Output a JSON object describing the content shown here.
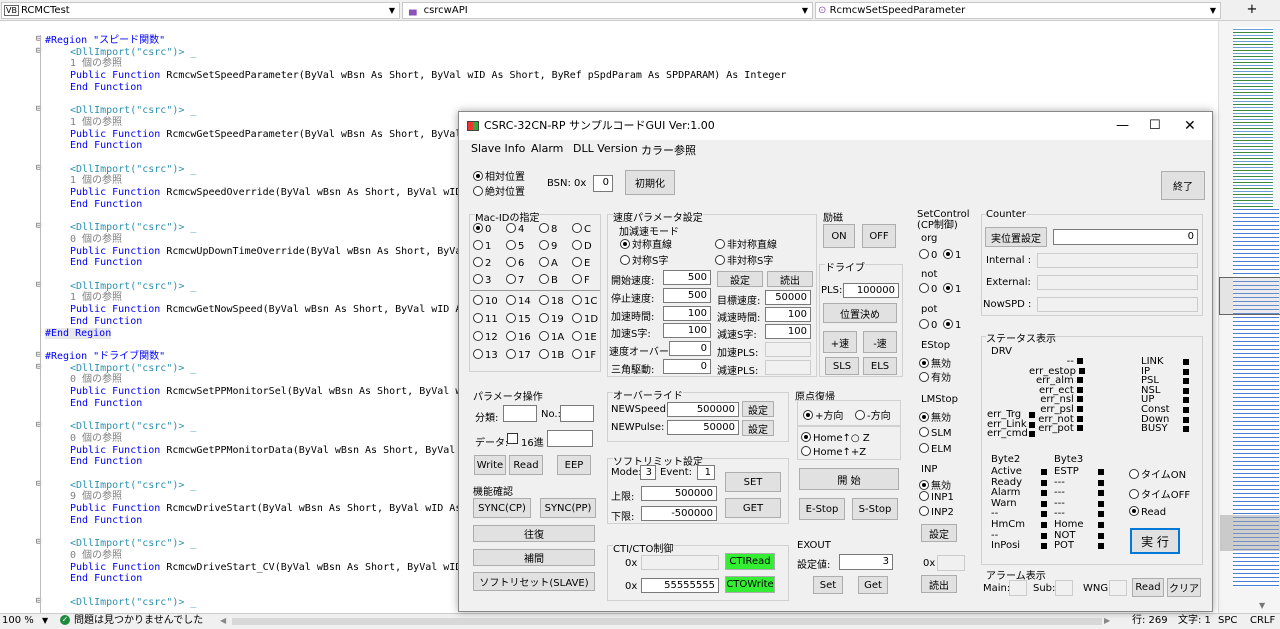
{
  "nav": {
    "project": "RCMCTest",
    "project_icon": "VB",
    "class": "csrcwAPI",
    "member": "RcmcwSetSpeedParameter",
    "split": "+"
  },
  "code": [
    {
      "t": "region",
      "text": "#Region \"スピード関数\""
    },
    {
      "t": "attr",
      "text": "<DllImport(\"csrc\")> _"
    },
    {
      "t": "ref",
      "text": "1 個の参照"
    },
    {
      "t": "fn",
      "pre": "Public Function ",
      "name": "RcmcwSetSpeedParameter",
      "args": "(ByVal wBsn As Short, ByVal wID As Short, ByRef pSpdParam As SPDPARAM) As Integer"
    },
    {
      "t": "end",
      "text": "End Function"
    },
    {
      "t": "blank",
      "text": ""
    },
    {
      "t": "attr",
      "text": "<DllImport(\"csrc\")> _"
    },
    {
      "t": "ref",
      "text": "1 個の参照"
    },
    {
      "t": "fn",
      "pre": "Public Function ",
      "name": "RcmcwGetSpeedParameter",
      "args": "(ByVal wBsn As Short, ByVal"
    },
    {
      "t": "end",
      "text": "End Function"
    },
    {
      "t": "blank",
      "text": ""
    },
    {
      "t": "attr",
      "text": "<DllImport(\"csrc\")> _"
    },
    {
      "t": "ref",
      "text": "1 個の参照"
    },
    {
      "t": "fn",
      "pre": "Public Function ",
      "name": "RcmcwSpeedOverride",
      "args": "(ByVal wBsn As Short, ByVal wID"
    },
    {
      "t": "end",
      "text": "End Function"
    },
    {
      "t": "blank",
      "text": ""
    },
    {
      "t": "attr",
      "text": "<DllImport(\"csrc\")> _"
    },
    {
      "t": "ref",
      "text": "0 個の参照"
    },
    {
      "t": "fn",
      "pre": "Public Function ",
      "name": "RcmcwUpDownTimeOverride",
      "args": "(ByVal wBsn As Short, ByVa"
    },
    {
      "t": "end",
      "text": "End Function"
    },
    {
      "t": "blank",
      "text": ""
    },
    {
      "t": "attr",
      "text": "<DllImport(\"csrc\")> _"
    },
    {
      "t": "ref",
      "text": "1 個の参照"
    },
    {
      "t": "fn",
      "pre": "Public Function ",
      "name": "RcmcwGetNowSpeed",
      "args": "(ByVal wBsn As Short, ByVal wID A"
    },
    {
      "t": "end",
      "text": "End Function"
    },
    {
      "t": "endregion",
      "text": "#End Region"
    },
    {
      "t": "blank",
      "text": ""
    },
    {
      "t": "region",
      "text": "#Region \"ドライブ関数\""
    },
    {
      "t": "attr",
      "text": "<DllImport(\"csrc\")> _"
    },
    {
      "t": "ref",
      "text": "0 個の参照"
    },
    {
      "t": "fn",
      "pre": "Public Function ",
      "name": "RcmcwSetPPMonitorSel",
      "args": "(ByVal wBsn As Short, ByVal w"
    },
    {
      "t": "end",
      "text": "End Function"
    },
    {
      "t": "blank",
      "text": ""
    },
    {
      "t": "attr",
      "text": "<DllImport(\"csrc\")> _"
    },
    {
      "t": "ref",
      "text": "0 個の参照"
    },
    {
      "t": "fn",
      "pre": "Public Function ",
      "name": "RcmcwGetPPMonitorData",
      "args": "(ByVal wBsn As Short, ByVal"
    },
    {
      "t": "end",
      "text": "End Function"
    },
    {
      "t": "blank",
      "text": ""
    },
    {
      "t": "attr",
      "text": "<DllImport(\"csrc\")> _"
    },
    {
      "t": "ref",
      "text": "9 個の参照"
    },
    {
      "t": "fn",
      "pre": "Public Function ",
      "name": "RcmcwDriveStart",
      "args": "(ByVal wBsn As Short, ByVal wID As"
    },
    {
      "t": "end",
      "text": "End Function"
    },
    {
      "t": "blank",
      "text": ""
    },
    {
      "t": "attr",
      "text": "<DllImport(\"csrc\")> _"
    },
    {
      "t": "ref",
      "text": "0 個の参照"
    },
    {
      "t": "fn",
      "pre": "Public Function ",
      "name": "RcmcwDriveStart_CV",
      "args": "(ByVal wBsn As Short, ByVal wID"
    },
    {
      "t": "end",
      "text": "End Function"
    },
    {
      "t": "blank",
      "text": ""
    },
    {
      "t": "attr",
      "text": "<DllImport(\"csrc\")> _"
    }
  ],
  "status": {
    "zoom": "100 %",
    "issues": "問題は見つかりませんでした",
    "line": "行: 269",
    "char": "文字: 1",
    "spc": "SPC",
    "crlf": "CRLF"
  },
  "dlg": {
    "title": "CSRC-32CN-RP サンプルコードGUI Ver:1.00",
    "menu": [
      "Slave Info",
      "Alarm",
      "DLL Version",
      "カラー参照"
    ],
    "pos_rel": "相対位置",
    "pos_abs": "絶対位置",
    "bsn_label": "BSN: 0x",
    "bsn_value": "0",
    "init": "初期化",
    "exit": "終了",
    "mac_title": "Mac-IDの指定",
    "mac_ids": [
      "0",
      "4",
      "8",
      "C",
      "1",
      "5",
      "9",
      "D",
      "2",
      "6",
      "A",
      "E",
      "3",
      "7",
      "B",
      "F",
      "10",
      "14",
      "18",
      "1C",
      "11",
      "15",
      "19",
      "1D",
      "12",
      "16",
      "1A",
      "1E",
      "13",
      "17",
      "1B",
      "1F"
    ],
    "speed": {
      "title": "速度パラメータ設定",
      "mode": "加減速モード",
      "sym_lin": "対称直線",
      "asym_lin": "非対称直線",
      "sym_s": "対称S字",
      "asym_s": "非対称S字",
      "start_lbl": "開始速度:",
      "start": "500",
      "stop_lbl": "停止速度:",
      "stop": "500",
      "acc_lbl": "加速時間:",
      "acc": "100",
      "accs_lbl": "加速S字:",
      "accs": "100",
      "over_lbl": "速度オーバー:",
      "over": "0",
      "tri_lbl": "三角駆動:",
      "tri": "0",
      "set": "設定",
      "read": "読出",
      "tgt_lbl": "目標速度:",
      "tgt": "50000",
      "dec_lbl": "減速時間:",
      "dec": "100",
      "decs_lbl": "減速S字:",
      "decs": "100",
      "accpls_lbl": "加速PLS:",
      "decpls_lbl": "減速PLS:"
    },
    "exc": {
      "title": "励磁",
      "on": "ON",
      "off": "OFF"
    },
    "drive": {
      "title": "ドライブ",
      "pls_lbl": "PLS:",
      "pls": "100000",
      "pos": "位置決め",
      "plus": "+速",
      "minus": "-速",
      "sls": "SLS",
      "els": "ELS"
    },
    "setctrl": {
      "title": "SetControl (CP制御)",
      "org": "org",
      "not": "not",
      "pot": "pot",
      "zero": "0",
      "one": "1",
      "estop": "EStop",
      "valid": "無効",
      "enabled": "有効"
    },
    "counter": {
      "title": "Counter",
      "actual": "実位置設定",
      "actual_val": "0",
      "internal": "Internal :",
      "external": "External:",
      "nowspd": "NowSPD :"
    },
    "st": {
      "title": "ステータス表示",
      "drv": "DRV",
      "mid": [
        "--",
        "err_estop",
        "err_alm",
        "err_ect",
        "err_nsl",
        "err_psl",
        "err_not",
        "err_pot"
      ],
      "left": [
        "err_Trg",
        "err_Link",
        "err_cmd"
      ],
      "right": [
        "LINK",
        "IP",
        "PSL",
        "NSL",
        "UP",
        "Const",
        "Down",
        "BUSY"
      ],
      "b2_title": "Byte2",
      "b2": [
        "Active",
        "Ready",
        "Alarm",
        "Warn",
        "--",
        "HmCm",
        "--",
        "InPosi"
      ],
      "b3_title": "Byte3",
      "b3": [
        "ESTP",
        "---",
        "---",
        "---",
        "---",
        "Home",
        "NOT",
        "POT"
      ],
      "t_on": "タイムON",
      "t_off": "タイムOFF",
      "read": "Read",
      "exec": "実 行"
    },
    "alarm": {
      "title": "アラーム表示",
      "main": "Main:",
      "sub": "Sub:",
      "wng": "WNG:",
      "read": "Read",
      "clear": "クリア"
    },
    "param": {
      "title": "パラメータ操作",
      "kind": "分類:",
      "no": "No.:",
      "data": "データ:",
      "hex": "16進",
      "write": "Write",
      "read": "Read",
      "eep": "EEP"
    },
    "func": {
      "title": "機能確認",
      "cp": "SYNC(CP)",
      "pp": "SYNC(PP)",
      "recip": "往復",
      "interp": "補間",
      "reset": "ソフトリセット(SLAVE)"
    },
    "ovr": {
      "title": "オーバーライド",
      "speed_lbl": "NEWSpeed:",
      "speed": "500000",
      "pulse_lbl": "NEWPulse:",
      "pulse": "50000",
      "set": "設定"
    },
    "soft": {
      "title": "ソフトリミット設定",
      "mode_lbl": "Mode:",
      "mode": "3",
      "event_lbl": "Event:",
      "event": "1",
      "up_lbl": "上限:",
      "up": "500000",
      "lo_lbl": "下限:",
      "lo": "-500000",
      "set": "SET",
      "get": "GET"
    },
    "cti": {
      "title": "CTI/CTO制御",
      "ox": "0x",
      "cti_read": "CTIRead",
      "cto_val": "55555555",
      "cto_write": "CTOWrite"
    },
    "home": {
      "title": "原点復帰",
      "plus": "+方向",
      "minus": "-方向",
      "h1": "Home↑○ Z",
      "h2": "Home↑+Z",
      "start": "開 始",
      "estop": "E-Stop",
      "sstop": "S-Stop"
    },
    "lm": {
      "title": "LMStop",
      "invalid": "無効",
      "slm": "SLM",
      "elm": "ELM"
    },
    "inp": {
      "title": "INP",
      "invalid": "無効",
      "inp1": "INP1",
      "inp2": "INP2",
      "set": "設定",
      "ox": "0x",
      "read": "読出"
    },
    "exout": {
      "title": "EXOUT",
      "lbl": "設定値:",
      "val": "3",
      "set": "Set",
      "get": "Get"
    }
  }
}
